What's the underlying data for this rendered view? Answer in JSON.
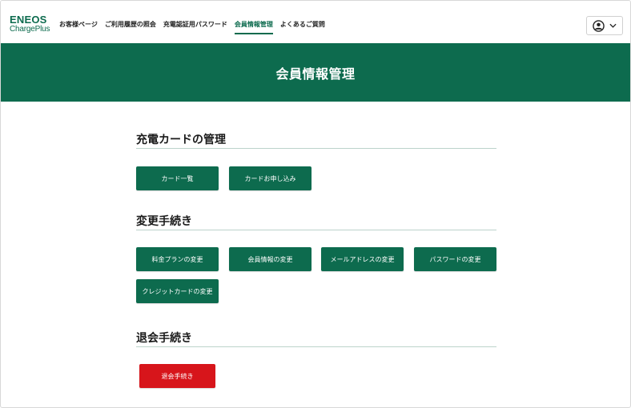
{
  "header": {
    "logo_top": "ENEOS",
    "logo_bottom": "ChargePlus",
    "nav": [
      {
        "label": "お客様ページ"
      },
      {
        "label": "ご利用履歴の照会"
      },
      {
        "label": "充電認証用パスワード"
      },
      {
        "label": "会員情報管理"
      },
      {
        "label": "よくあるご質問"
      }
    ],
    "active_nav": "会員情報管理",
    "account_icon": "user-circle-icon",
    "dropdown_icon": "chevron-down-icon"
  },
  "banner": {
    "title": "会員情報管理"
  },
  "sections": {
    "card": {
      "title": "充電カードの管理",
      "buttons": [
        "カード一覧",
        "カードお申し込み"
      ]
    },
    "change": {
      "title": "変更手続き",
      "buttons": [
        "料金プランの変更",
        "会員情報の変更",
        "メールアドレスの変更",
        "パスワードの変更",
        "クレジットカードの変更"
      ]
    },
    "withdraw": {
      "title": "退会手続き",
      "button": "退会手続き"
    }
  },
  "colors": {
    "brand": "#0d6b4e",
    "danger": "#d7151b"
  }
}
